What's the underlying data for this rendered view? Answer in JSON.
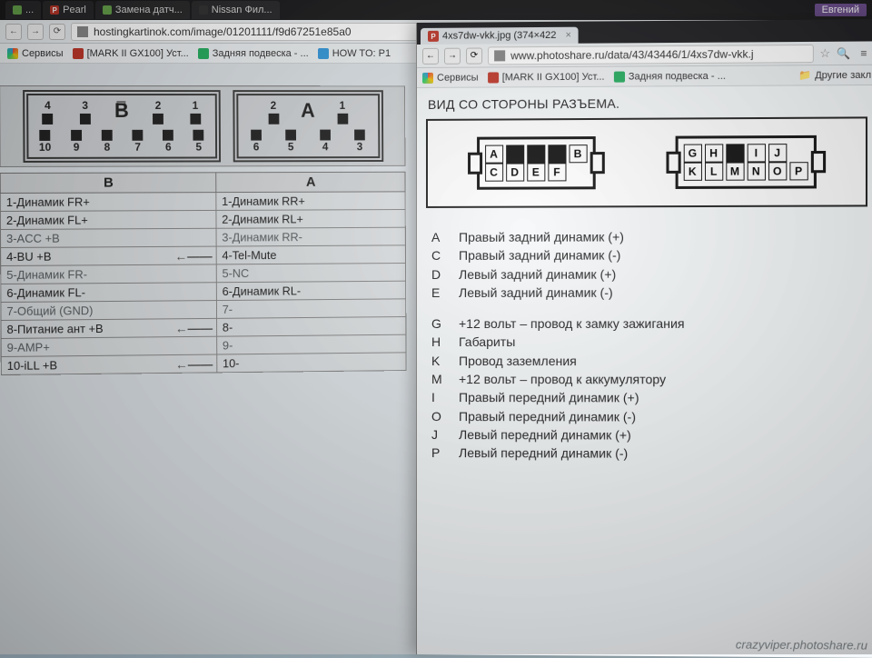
{
  "top_tabs": [
    {
      "label": "..."
    },
    {
      "label": "Pearl"
    },
    {
      "label": "Замена датч..."
    },
    {
      "label": "Nissan Фил..."
    }
  ],
  "user_badge": "Евгений",
  "back": {
    "url": "hostingkartinok.com/image/01201111/f9d67251e85a0",
    "bookmarks": {
      "services": "Сервисы",
      "mark2": "[MARK II GX100] Уст...",
      "susp": "Задняя подвеска - ...",
      "howto": "HOW TO: P1"
    },
    "conn_labels": {
      "b": "B",
      "a": "A"
    },
    "table_headers": {
      "b": "B",
      "a": "A"
    },
    "rows": [
      {
        "b": "1-Динамик FR+",
        "a": "1-Динамик RR+"
      },
      {
        "b": "2-Динамик FL+",
        "a": "2-Динамик RL+"
      },
      {
        "b": "3-ACC +B",
        "a": "3-Динамик RR-",
        "dim": true
      },
      {
        "b": "4-BU +B",
        "a": "4-Tel-Mute",
        "arrow": true
      },
      {
        "b": "5-Динамик FR-",
        "a": "5-NC",
        "dim": true
      },
      {
        "b": "6-Динамик FL-",
        "a": "6-Динамик RL-"
      },
      {
        "b": "7-Общий (GND)",
        "a": "7-",
        "dim": true
      },
      {
        "b": "8-Питание ант +B",
        "a": "8-",
        "arrow": true
      },
      {
        "b": "9-AMP+",
        "a": "9-",
        "dim": true
      },
      {
        "b": "10-iLL +B",
        "a": "10-",
        "arrow": true
      }
    ],
    "pins_b_top": [
      "4",
      "3",
      "",
      "2",
      "1"
    ],
    "pins_b_bot": [
      "10",
      "9",
      "8",
      "7",
      "6",
      "5"
    ],
    "pins_a_top": [
      "2",
      "1"
    ],
    "pins_a_bot": [
      "6",
      "5",
      "4",
      "3"
    ]
  },
  "front": {
    "tab_label": "4xs7dw-vkk.jpg (374×422",
    "url": "www.photoshare.ru/data/43/43446/1/4xs7dw-vkk.j",
    "bookmarks": {
      "services": "Сервисы",
      "mark2": "[MARK II GX100] Уст...",
      "susp": "Задняя подвеска - ...",
      "other": "Другие закл"
    },
    "title": "ВИД СО СТОРОНЫ РАЗЪЕМА.",
    "iso_left_top": [
      "A",
      "",
      "",
      "",
      "B"
    ],
    "iso_left_bot": [
      "C",
      "D",
      "E",
      "F"
    ],
    "iso_right_top": [
      "G",
      "H",
      "",
      "I",
      "J"
    ],
    "iso_right_bot": [
      "K",
      "L",
      "M",
      "N",
      "O",
      "P"
    ],
    "legend": [
      {
        "k": "A",
        "t": "Правый задний динамик (+)"
      },
      {
        "k": "C",
        "t": "Правый задний динамик (-)"
      },
      {
        "k": "D",
        "t": "Левый задний динамик (+)"
      },
      {
        "k": "E",
        "t": "Левый задний динамик (-)"
      },
      {
        "gap": true
      },
      {
        "k": "G",
        "t": "+12 вольт – провод к замку зажигания"
      },
      {
        "k": "H",
        "t": "Габариты"
      },
      {
        "k": "K",
        "t": "Провод заземления"
      },
      {
        "k": "M",
        "t": "+12 вольт – провод к аккумулятору"
      },
      {
        "k": "I",
        "t": "Правый передний динамик (+)"
      },
      {
        "k": "O",
        "t": "Правый передний динамик (-)"
      },
      {
        "k": "J",
        "t": "Левый передний динамик (+)"
      },
      {
        "k": "P",
        "t": "Левый передний динамик (-)"
      }
    ],
    "watermark": "crazyviper.photoshare.ru"
  }
}
